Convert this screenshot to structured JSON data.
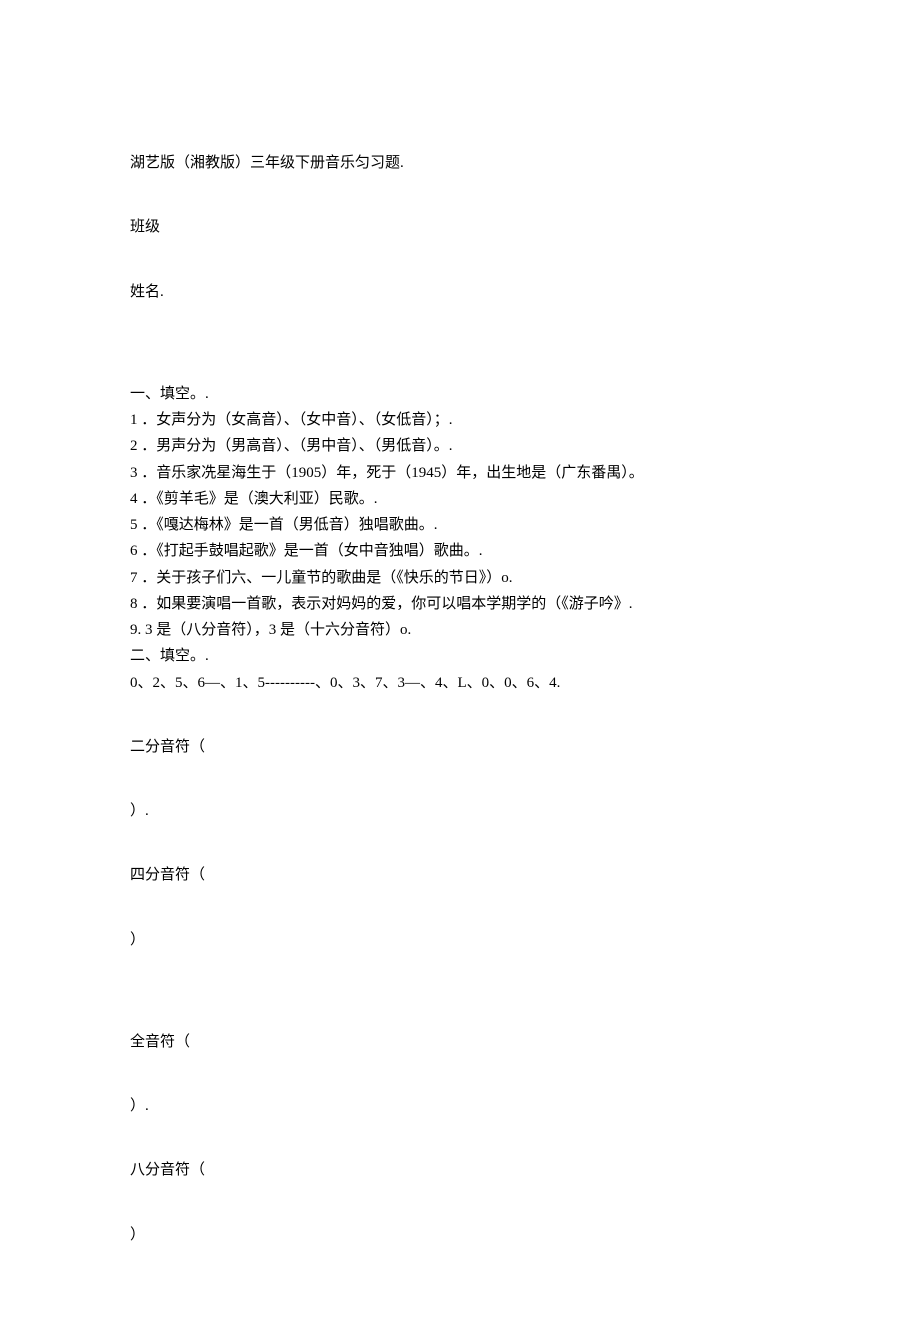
{
  "title": "湖艺版（湘教版）三年级下册音乐匀习题.",
  "class_label": "班级",
  "name_label": "姓名.",
  "section1_header": "一、填空。.",
  "q1": "1 ．女声分为（女高音）、（女中音）、（女低音）；.",
  "q2": "2 ．男声分为（男高音）、（男中音）、（男低音）。.",
  "q3": "3 ．音乐家冼星海生于（1905）年，死于（1945）年，出生地是（广东番禺）。",
  "q4": "4 ．《剪羊毛》是（澳大利亚）民歌。.",
  "q5": "5 ．《嘎达梅林》是一首（男低音）独唱歌曲。.",
  "q6": "6 ．《打起手鼓唱起歌》是一首（女中音独唱）歌曲。.",
  "q7": "7 ．关于孩子们六、一儿童节的歌曲是（《快乐的节日》）o.",
  "q8": "8 ．如果要演唱一首歌，表示对妈妈的爱，你可以唱本学期学的（《游子吟》.",
  "q9": "9. 3 是（八分音符），3 是（十六分音符）o.",
  "section2_header": "二、填空。.",
  "list_line": "0、2、5、6—、1、5----------、0、3、7、3—、4、L、0、0、6、4.",
  "note_half": "二分音符（",
  "note_quarter": "四分音符（",
  "note_whole": "全音符（",
  "note_eighth": "八分音符（",
  "close_dot": "）.",
  "close_plain": "）"
}
